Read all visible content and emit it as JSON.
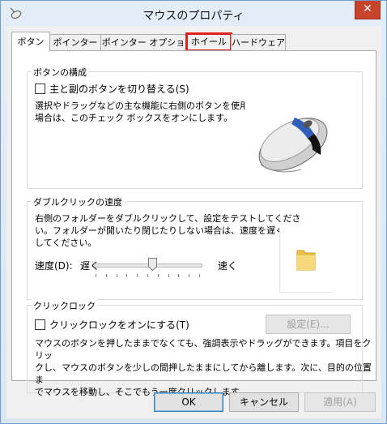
{
  "window": {
    "title": "マウスのプロパティ",
    "close_glyph": "✕"
  },
  "tabs": [
    {
      "label": "ボタン"
    },
    {
      "label": "ポインター"
    },
    {
      "label": "ポインター オプション"
    },
    {
      "label": "ホイール"
    },
    {
      "label": "ハードウェア"
    }
  ],
  "button_config": {
    "title": "ボタンの構成",
    "checkbox_label": "主と副のボタンを切り替える(S)",
    "desc_line1": "選択やドラッグなどの主な機能に右側のボタンを使用する",
    "desc_line2": "場合は、このチェック ボックスをオンにします。"
  },
  "double_click": {
    "title": "ダブルクリックの速度",
    "desc_line1": "右側のフォルダーをダブルクリックして、設定をテストしてくださ",
    "desc_line2": "い。フォルダーが開いたり閉じたりしない場合は、速度を遅く",
    "desc_line3": "してください。",
    "speed_label": "速度(D):",
    "slow_label": "遅く",
    "fast_label": "速く",
    "speed_level": 0.55
  },
  "click_lock": {
    "title": "クリックロック",
    "checkbox_label": "クリックロックをオンにする(T)",
    "settings_button": "設定(E)...",
    "desc_line1": "マウスのボタンを押したままでなくても、強調表示やドラッグができます。項目をクリッ",
    "desc_line2": "クし、マウスのボタンを少しの間押したままにしてから離します。次に、目的の位置ま",
    "desc_line3": "でマウスを移動し、そこでもう一度クリックします。"
  },
  "footer": {
    "ok": "OK",
    "cancel": "キャンセル",
    "apply": "適用(A)"
  }
}
